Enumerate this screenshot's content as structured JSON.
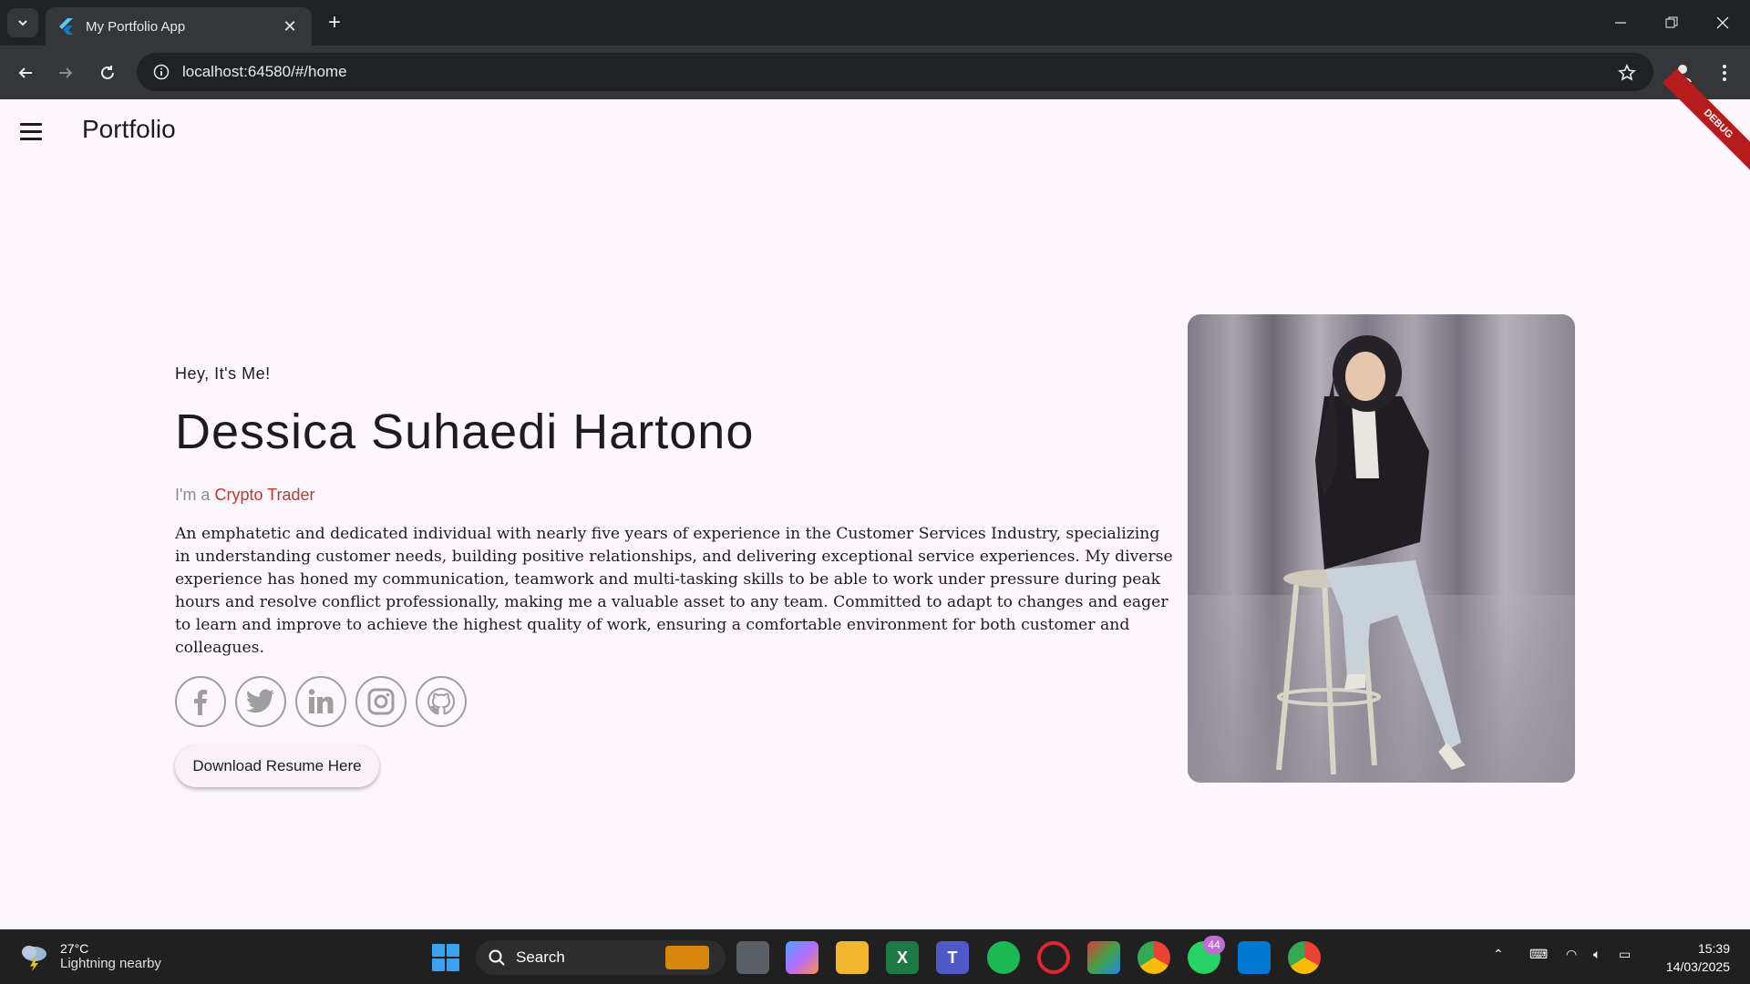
{
  "browser": {
    "tab_title": "My Portfolio App",
    "url": "localhost:64580/#/home"
  },
  "app": {
    "title": "Portfolio",
    "debug_banner": "DEBUG"
  },
  "hero": {
    "greeting": "Hey, It's Me!",
    "name": "Dessica Suhaedi Hartono",
    "role_prefix": "I'm a",
    "role_accent": "Crypto Trader",
    "bio": "An emphatetic and dedicated individual with nearly five years of experience in the Customer Services Industry, specializing in understanding customer needs, building positive relationships, and delivering exceptional service experiences. My diverse experience has honed my communication, teamwork and multi-tasking skills to be able to work under pressure during peak hours and resolve conflict professionally, making me a valuable asset to any team. Committed to adapt to changes and eager to learn and improve to achieve the highest quality of work, ensuring a comfortable environment for both customer and colleagues.",
    "socials": [
      "facebook-icon",
      "twitter-icon",
      "linkedin-icon",
      "instagram-icon",
      "github-icon"
    ],
    "resume_button": "Download Resume Here",
    "accent_color": "#c0392b"
  },
  "taskbar": {
    "weather_temp": "27°C",
    "weather_desc": "Lightning nearby",
    "search_label": "Search",
    "whatsapp_badge": "44",
    "time": "15:39",
    "date": "14/03/2025"
  }
}
